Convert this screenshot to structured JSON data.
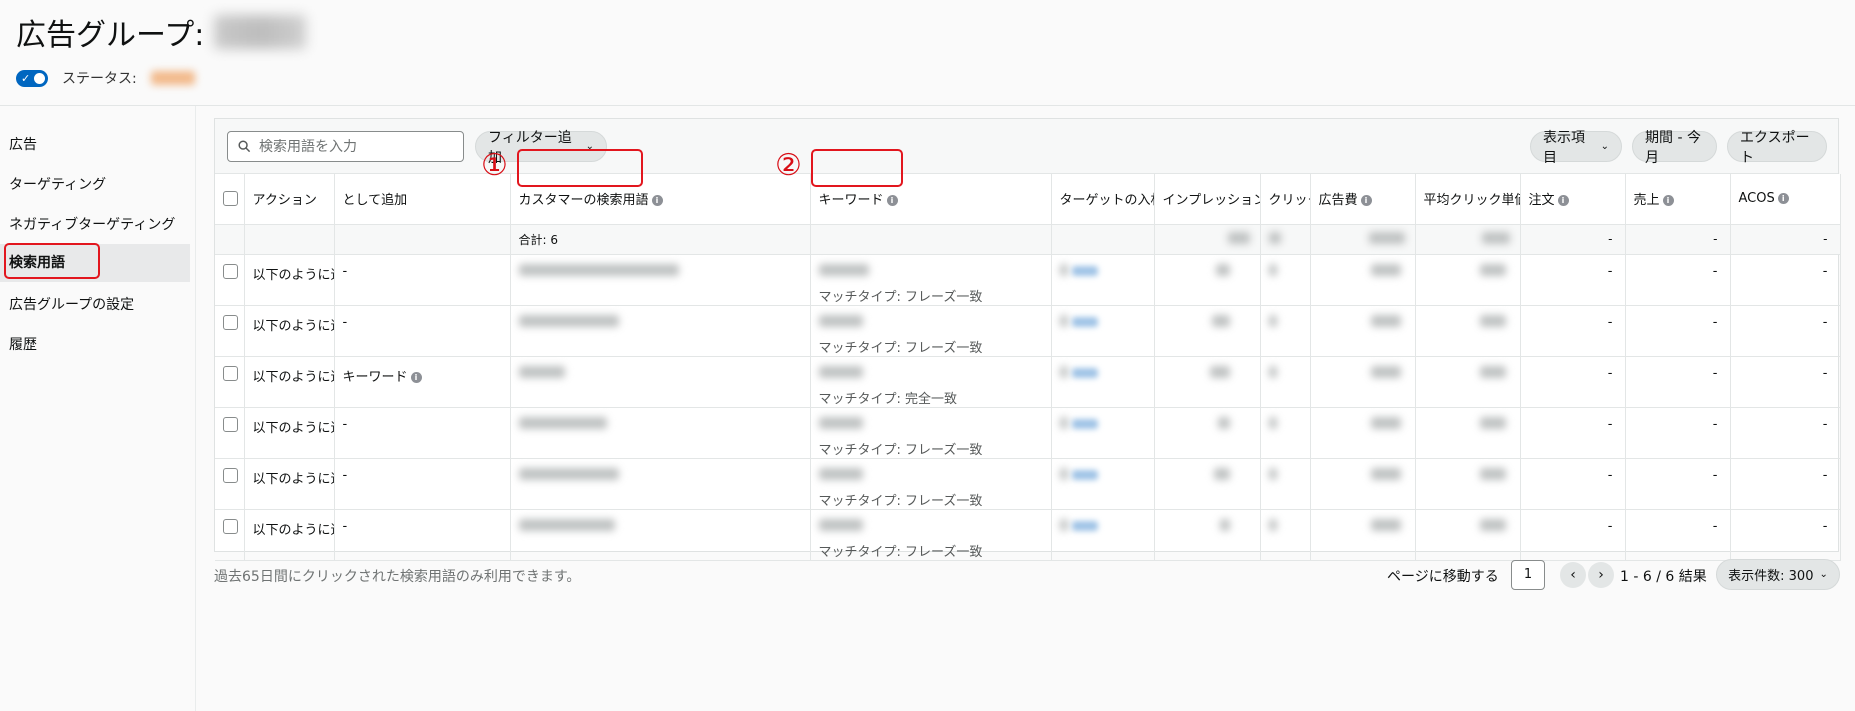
{
  "header": {
    "title": "広告グループ:",
    "status_label": "ステータス:"
  },
  "sidebar": {
    "items": [
      {
        "label": "広告"
      },
      {
        "label": "ターゲティング"
      },
      {
        "label": "ネガティブターゲティング"
      },
      {
        "label": "検索用語"
      },
      {
        "label": "広告グループの設定"
      },
      {
        "label": "履歴"
      }
    ],
    "active_index": 3
  },
  "toolbar": {
    "search_placeholder": "検索用語を入力",
    "filter_label": "フィルター追加",
    "columns_label": "表示項目",
    "period_label": "期間 - 今月",
    "export_label": "エクスポート"
  },
  "table": {
    "headers": {
      "action": "アクション",
      "add_as": "として追加",
      "customer_search_term": "カスタマーの検索用語",
      "keyword": "キーワード",
      "target_bid": "ターゲットの入札",
      "impressions": "インプレッション",
      "clicks": "クリック",
      "spend": "広告費",
      "cpc": "平均クリック単価",
      "orders": "注文",
      "sales": "売上",
      "acos": "ACOS"
    },
    "total_label": "合計: 6",
    "total_dash": "-",
    "rows": [
      {
        "action": "以下のように追加",
        "add_as": "-",
        "match_type": "マッチタイプ: フレーズ一致",
        "orders": "-",
        "sales": "-",
        "acos": "-"
      },
      {
        "action": "以下のように追加",
        "add_as": "-",
        "match_type": "マッチタイプ: フレーズ一致",
        "orders": "-",
        "sales": "-",
        "acos": "-"
      },
      {
        "action": "以下のように追加",
        "add_as": "キーワード",
        "match_type": "マッチタイプ: 完全一致",
        "orders": "-",
        "sales": "-",
        "acos": "-"
      },
      {
        "action": "以下のように追加",
        "add_as": "-",
        "match_type": "マッチタイプ: フレーズ一致",
        "orders": "-",
        "sales": "-",
        "acos": "-"
      },
      {
        "action": "以下のように追加",
        "add_as": "-",
        "match_type": "マッチタイプ: フレーズ一致",
        "orders": "-",
        "sales": "-",
        "acos": "-"
      },
      {
        "action": "以下のように追加",
        "add_as": "-",
        "match_type": "マッチタイプ: フレーズ一致",
        "orders": "-",
        "sales": "-",
        "acos": "-"
      }
    ]
  },
  "annotations": {
    "marker_1": "①",
    "marker_2": "②",
    "color": "#e2161e"
  },
  "footer": {
    "note": "過去65日間にクリックされた検索用語のみ利用できます。",
    "goto_label": "ページに移動する",
    "page_value": "1",
    "result_count": "1 - 6 / 6 結果",
    "page_size_label": "表示件数: 300"
  },
  "icons": [
    "search-icon",
    "chevron-down-icon",
    "info-icon",
    "chevron-left-icon",
    "chevron-right-icon",
    "check-icon"
  ],
  "colors": {
    "accent": "#0066c0",
    "highlight": "#e2161e"
  }
}
